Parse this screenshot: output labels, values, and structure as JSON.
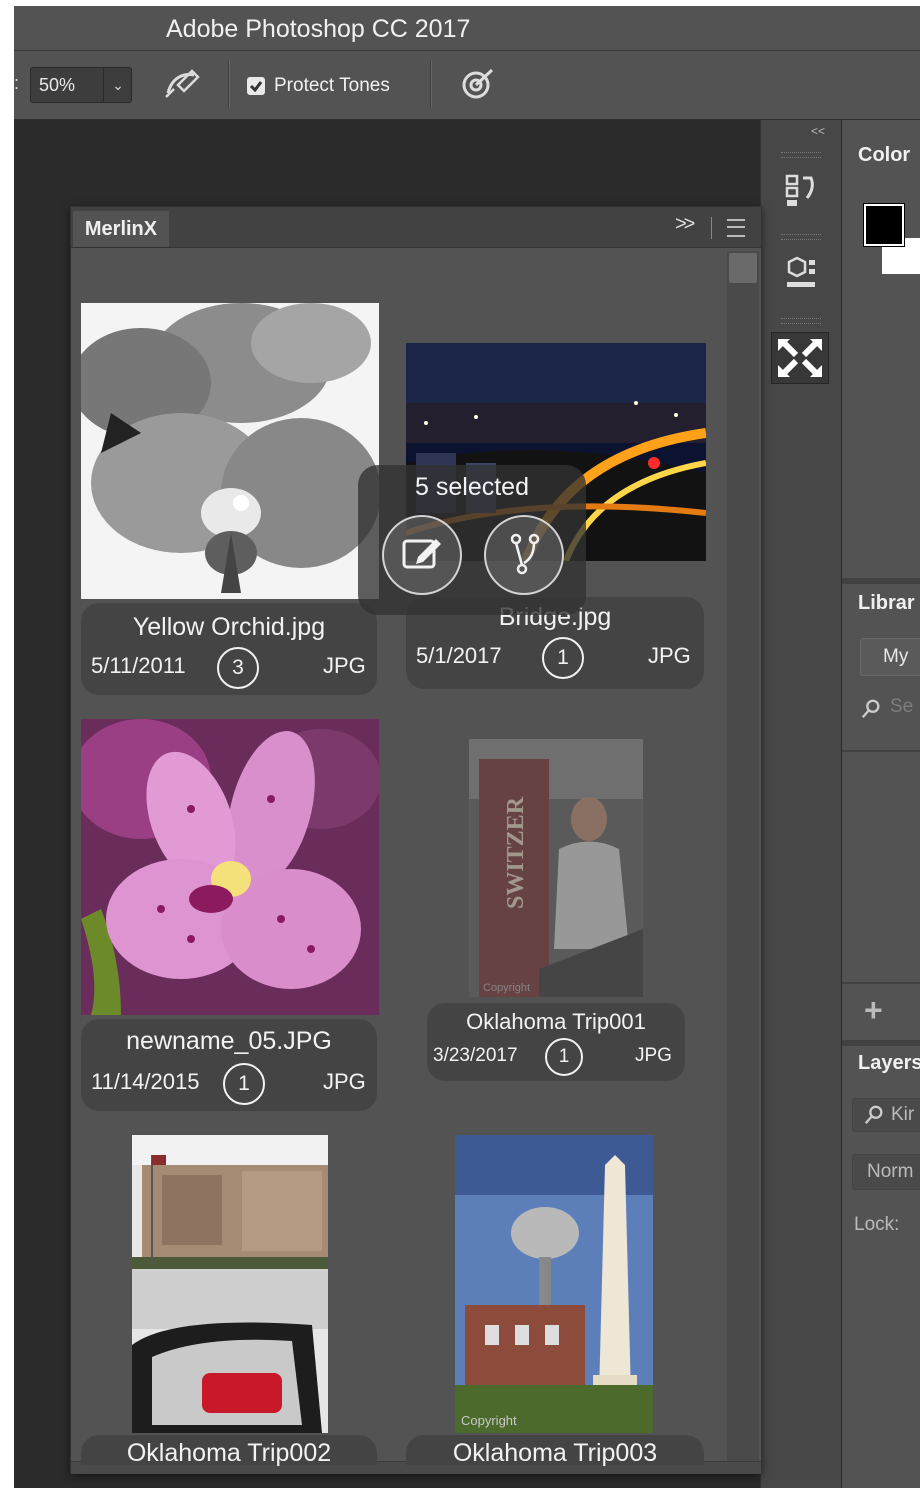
{
  "app": {
    "title": "Adobe Photoshop CC 2017"
  },
  "options_bar": {
    "colon": ":",
    "zoom_value": "50%",
    "zoom_caret": "⌄",
    "protect_tones_label": "Protect Tones",
    "protect_tones_checked": true
  },
  "dock_strip": {
    "collapse_label": "<<"
  },
  "dock": {
    "color_title": "Color",
    "libraries_title": "Librar",
    "libraries_select": "My",
    "libraries_search_placeholder": "Se",
    "add_label": "+",
    "layers_title": "Layers",
    "kind_filter": "Kir",
    "blend_mode": "Norm",
    "lock_label": "Lock:"
  },
  "panel": {
    "tab_label": "MerlinX",
    "expand_label": ">>",
    "selection_text": "5 selected",
    "items": [
      {
        "name": "Yellow Orchid.jpg",
        "date": "5/11/2011",
        "count": "3",
        "type": "JPG"
      },
      {
        "name": "Bridge.jpg",
        "date": "5/1/2017",
        "count": "1",
        "type": "JPG"
      },
      {
        "name": "newname_05.JPG",
        "date": "11/14/2015",
        "count": "1",
        "type": "JPG"
      },
      {
        "name": "Oklahoma Trip001",
        "date": "3/23/2017",
        "count": "1",
        "type": "JPG"
      },
      {
        "name": "Oklahoma Trip002"
      },
      {
        "name": "Oklahoma Trip003"
      }
    ],
    "photo_text": {
      "banner": "SWITZER",
      "copyright": "Copyright"
    }
  },
  "colors": {
    "app_bg": "#2b2b2b",
    "panel_bg": "#535353",
    "caption_bg": "#444444",
    "text": "#f2f2f2"
  }
}
